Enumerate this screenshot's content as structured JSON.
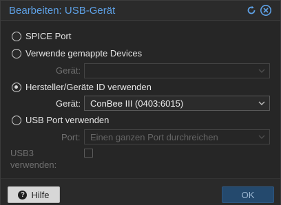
{
  "dialog": {
    "title": "Bearbeiten: USB-Gerät",
    "tools": {
      "reset_icon": "reset-icon",
      "close_icon": "close-icon"
    }
  },
  "options": [
    {
      "label": "SPICE Port",
      "checked": false
    },
    {
      "label": "Verwende gemappte Devices",
      "checked": false
    },
    {
      "label": "Hersteller/Geräte ID verwenden",
      "checked": true
    },
    {
      "label": "USB Port verwenden",
      "checked": false
    }
  ],
  "mapped_device": {
    "label": "Gerät:",
    "value": "",
    "enabled": false
  },
  "vendor_device": {
    "label": "Gerät:",
    "value": "ConBee III (0403:6015)",
    "enabled": true
  },
  "usb_port": {
    "label": "Port:",
    "placeholder": "Einen ganzen Port durchreichen",
    "enabled": false
  },
  "usb3": {
    "label_line1": "USB3",
    "label_line2": "verwenden:",
    "checked": false,
    "enabled": false
  },
  "footer": {
    "help_label": "Hilfe",
    "ok_label": "OK"
  },
  "colors": {
    "accent": "#5ea1e6",
    "ok_button": "#24496d"
  }
}
